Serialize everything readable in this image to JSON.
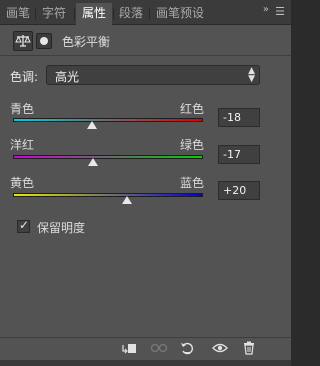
{
  "tabs": [
    {
      "label": "画笔",
      "active": false
    },
    {
      "label": "字符",
      "active": false
    },
    {
      "label": "属性",
      "active": true
    },
    {
      "label": "段落",
      "active": false
    },
    {
      "label": "画笔预设",
      "active": false
    }
  ],
  "header": {
    "icon_left": "balance-scale-icon",
    "icon_right": "mask-icon",
    "title": "色彩平衡"
  },
  "tone": {
    "label": "色调:",
    "value": "高光"
  },
  "sliders": [
    {
      "left_label": "青色",
      "right_label": "红色",
      "value": "-18",
      "colors": [
        "#00d0d8",
        "#e00000"
      ]
    },
    {
      "left_label": "洋红",
      "right_label": "绿色",
      "value": "-17",
      "colors": [
        "#d000d8",
        "#00d000"
      ]
    },
    {
      "left_label": "黄色",
      "right_label": "蓝色",
      "value": "+20",
      "colors": [
        "#e8e800",
        "#0000d8"
      ]
    }
  ],
  "preserve_luminosity": {
    "label": "保留明度",
    "checked": true
  },
  "toolbar_icons": [
    "clip-to-layer-icon",
    "view-previous-icon",
    "reset-icon",
    "visibility-eye-icon",
    "trash-icon"
  ]
}
